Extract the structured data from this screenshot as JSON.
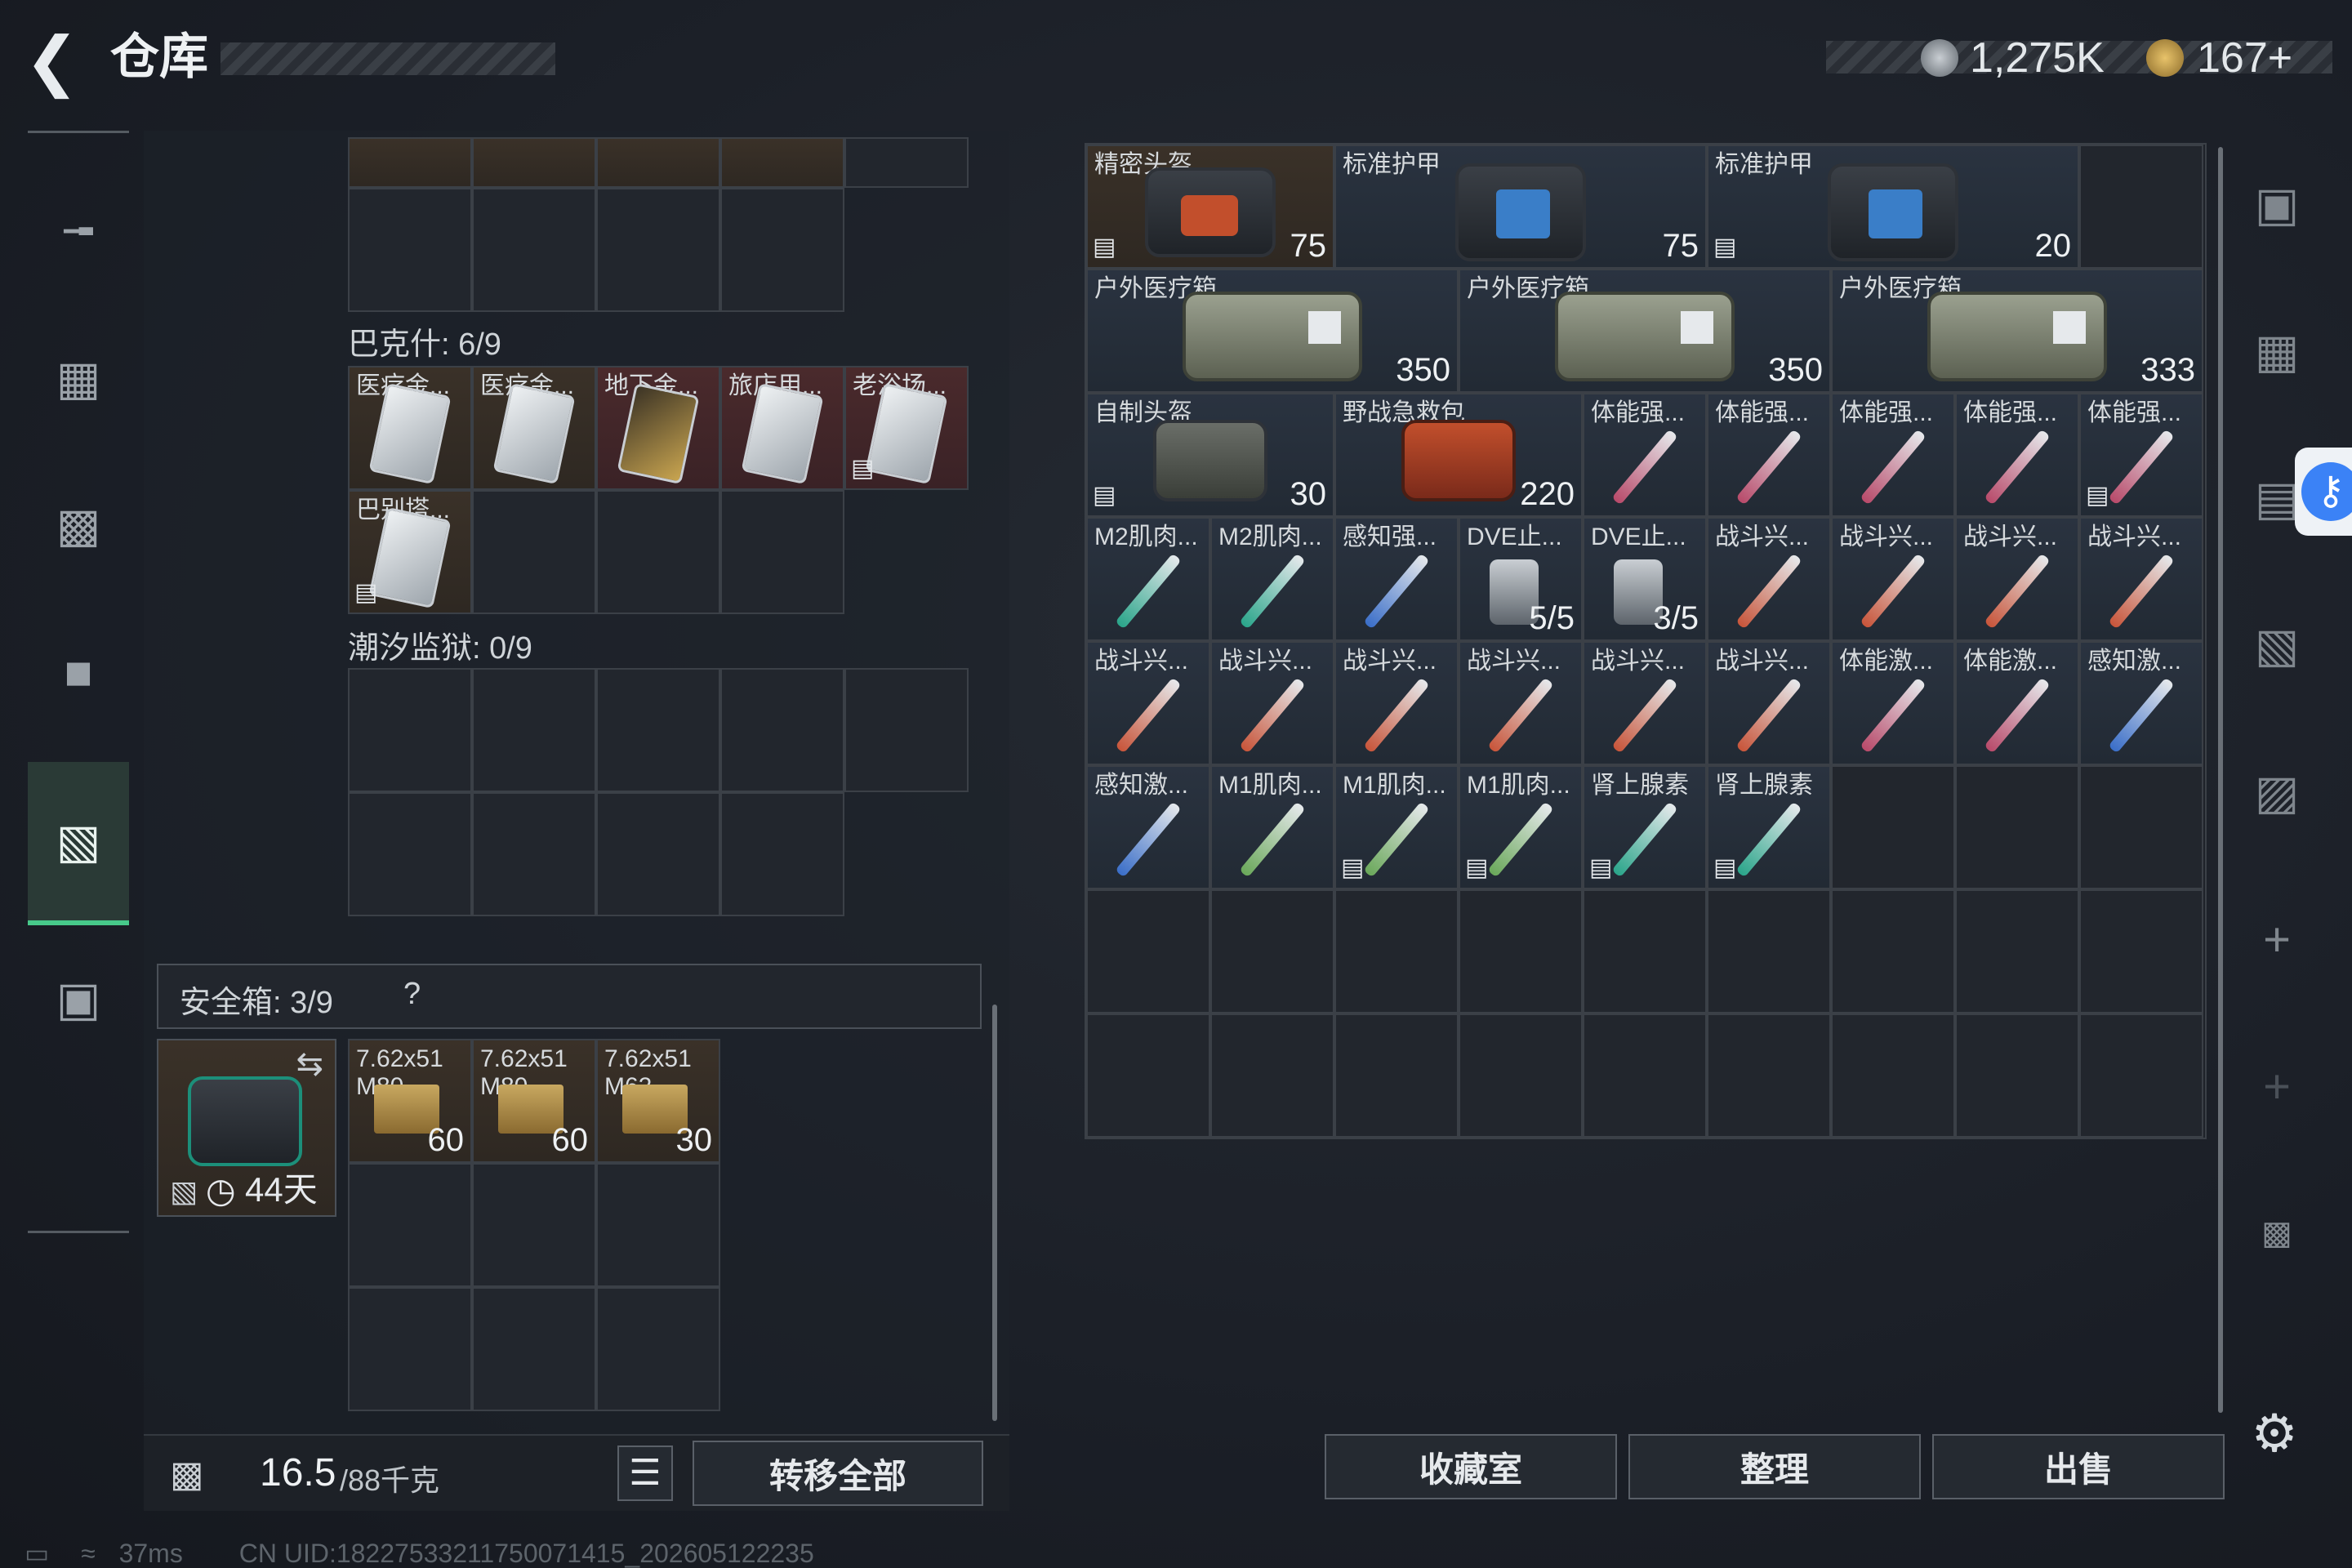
{
  "header": {
    "title": "仓库",
    "currency1": "1,275K",
    "currency2": "167+"
  },
  "left_sections": {
    "bakeshi_label": "巴克什: 6/9",
    "bakeshi_items": [
      "医疗金...",
      "医疗金...",
      "地下金...",
      "旅店用...",
      "老浴场...",
      "巴别塔..."
    ],
    "chaoxi_label": "潮汐监狱: 0/9",
    "safebox_label": "安全箱: 3/9",
    "safebox_help": "?",
    "safebox_timer": "44天",
    "ammo": [
      {
        "name": "7.62x51",
        "sub": "M80",
        "count": "60"
      },
      {
        "name": "7.62x51",
        "sub": "M80",
        "count": "60"
      },
      {
        "name": "7.62x51",
        "sub": "M62",
        "count": "30"
      }
    ],
    "weight": "16.5",
    "weight_max": "/88千克",
    "transfer_all": "转移全部"
  },
  "stash": {
    "row1": [
      {
        "name": "精密头盔",
        "value": "75"
      },
      {
        "name": "标准护甲",
        "value": "75"
      },
      {
        "name": "标准护甲",
        "value": "20"
      }
    ],
    "row2": [
      {
        "name": "户外医疗箱",
        "value": "350"
      },
      {
        "name": "户外医疗箱",
        "value": "350"
      },
      {
        "name": "户外医疗箱",
        "value": "333"
      }
    ],
    "row3_big": [
      {
        "name": "自制头盔",
        "value": "30"
      },
      {
        "name": "野战急救包",
        "value": "220"
      }
    ],
    "row3_small": [
      "体能强...",
      "体能强...",
      "体能强...",
      "体能强...",
      "体能强..."
    ],
    "row4": [
      {
        "name": "M2肌肉...",
        "count": ""
      },
      {
        "name": "M2肌肉...",
        "count": ""
      },
      {
        "name": "感知强...",
        "count": ""
      },
      {
        "name": "DVE止...",
        "count": "5/5"
      },
      {
        "name": "DVE止...",
        "count": "3/5"
      },
      {
        "name": "战斗兴...",
        "count": ""
      },
      {
        "name": "战斗兴...",
        "count": ""
      },
      {
        "name": "战斗兴...",
        "count": ""
      },
      {
        "name": "战斗兴...",
        "count": ""
      }
    ],
    "row5": [
      "战斗兴...",
      "战斗兴...",
      "战斗兴...",
      "战斗兴...",
      "战斗兴...",
      "战斗兴...",
      "体能激...",
      "体能激...",
      "感知激..."
    ],
    "row6": [
      "感知激...",
      "M1肌肉...",
      "M1肌肉...",
      "M1肌肉...",
      "肾上腺素",
      "肾上腺素"
    ]
  },
  "buttons": {
    "collection": "收藏室",
    "organize": "整理",
    "sell": "出售"
  },
  "status": {
    "ping": "37ms",
    "uid": "CN UID:18227533211750071415_202605122235"
  },
  "colors": {
    "accent": "#47c98a",
    "item_bg": "#3a3128",
    "red_item": "#4a2a2c",
    "blue_item": "#2a3340"
  }
}
